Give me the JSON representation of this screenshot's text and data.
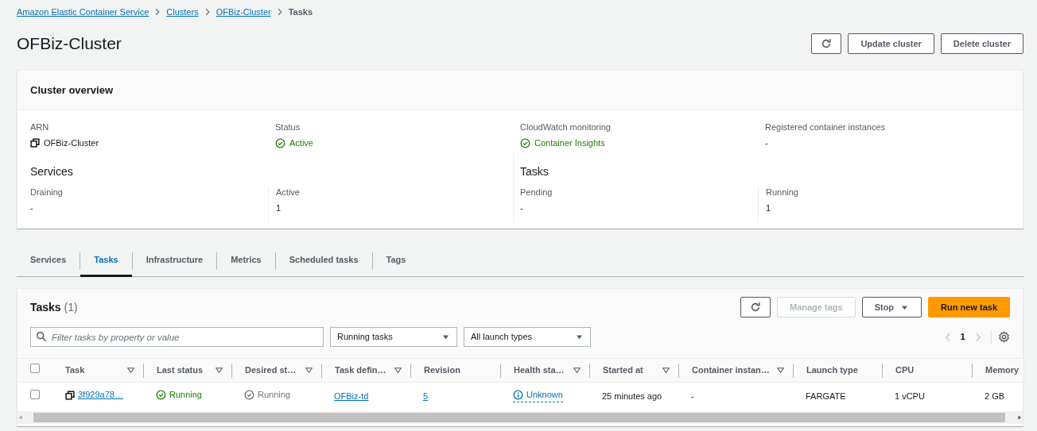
{
  "breadcrumbs": [
    {
      "label": "Amazon Elastic Container Service",
      "link": true
    },
    {
      "label": "Clusters",
      "link": true
    },
    {
      "label": "OFBiz-Cluster",
      "link": true
    },
    {
      "label": "Tasks",
      "link": false
    }
  ],
  "title": "OFBiz-Cluster",
  "header_buttons": [
    {
      "kind": "refresh"
    },
    {
      "kind": "text",
      "label": "Update cluster"
    },
    {
      "kind": "text",
      "label": "Delete cluster"
    }
  ],
  "overview": {
    "title": "Cluster overview",
    "fields": [
      {
        "label": "ARN",
        "value": "OFBiz-Cluster",
        "kind": "copy"
      },
      {
        "label": "Status",
        "value": "Active",
        "kind": "success"
      },
      {
        "label": "CloudWatch monitoring",
        "value": "Container Insights",
        "kind": "success"
      },
      {
        "label": "Registered container instances",
        "value": "-",
        "kind": "plain"
      }
    ],
    "sections": [
      {
        "title": "Services",
        "fields": [
          {
            "label": "Draining",
            "value": "-",
            "kind": "plain"
          },
          {
            "label": "Active",
            "value": "1",
            "kind": "plain"
          }
        ]
      },
      {
        "title": "Tasks",
        "fields": [
          {
            "label": "Pending",
            "value": "-",
            "kind": "plain"
          },
          {
            "label": "Running",
            "value": "1",
            "kind": "plain"
          }
        ]
      }
    ]
  },
  "tabs": [
    {
      "label": "Services",
      "selected": false
    },
    {
      "label": "Tasks",
      "selected": true
    },
    {
      "label": "Infrastructure",
      "selected": false
    },
    {
      "label": "Metrics",
      "selected": false
    },
    {
      "label": "Scheduled tasks",
      "selected": false
    },
    {
      "label": "Tags",
      "selected": false
    }
  ],
  "tasks_panel": {
    "title": "Tasks",
    "count": "(1)",
    "buttons": [
      {
        "kind": "refresh"
      },
      {
        "kind": "normal",
        "label": "Manage tags",
        "disabled": true
      },
      {
        "kind": "dropdown",
        "label": "Stop",
        "disabled": false
      },
      {
        "kind": "primary",
        "label": "Run new task",
        "disabled": false
      }
    ],
    "select_all": {
      "checked": false
    },
    "search": {
      "placeholder": "Filter tasks by property or value"
    },
    "selects": [
      "Running tasks",
      "All launch types"
    ],
    "page": "1",
    "columns": [
      {
        "label": "Task",
        "filter": true
      },
      {
        "label": "Last status",
        "filter": true
      },
      {
        "label": "Desired st…",
        "filter": true
      },
      {
        "label": "Task defin…",
        "filter": true
      },
      {
        "label": "Revision",
        "filter": false
      },
      {
        "label": "Health sta…",
        "filter": true
      },
      {
        "label": "Started at",
        "filter": true
      },
      {
        "label": "Container instan…",
        "filter": true
      },
      {
        "label": "Launch type",
        "filter": false
      },
      {
        "label": "CPU",
        "filter": false
      },
      {
        "label": "Memory",
        "filter": false
      }
    ],
    "rows": [
      {
        "selected": false,
        "cells": [
          {
            "text": "3f929a78…",
            "kind": "copy-link"
          },
          {
            "text": "Running",
            "kind": "success"
          },
          {
            "text": "Running",
            "kind": "neutral"
          },
          {
            "text": "OFBiz-td",
            "kind": "link"
          },
          {
            "text": "5",
            "kind": "link"
          },
          {
            "text": "Unknown",
            "kind": "info"
          },
          {
            "text": "25 minutes ago",
            "kind": "plain"
          },
          {
            "text": "-",
            "kind": "plain"
          },
          {
            "text": "FARGATE",
            "kind": "plain"
          },
          {
            "text": "1 vCPU",
            "kind": "plain"
          },
          {
            "text": "2 GB",
            "kind": "plain"
          }
        ]
      }
    ]
  }
}
